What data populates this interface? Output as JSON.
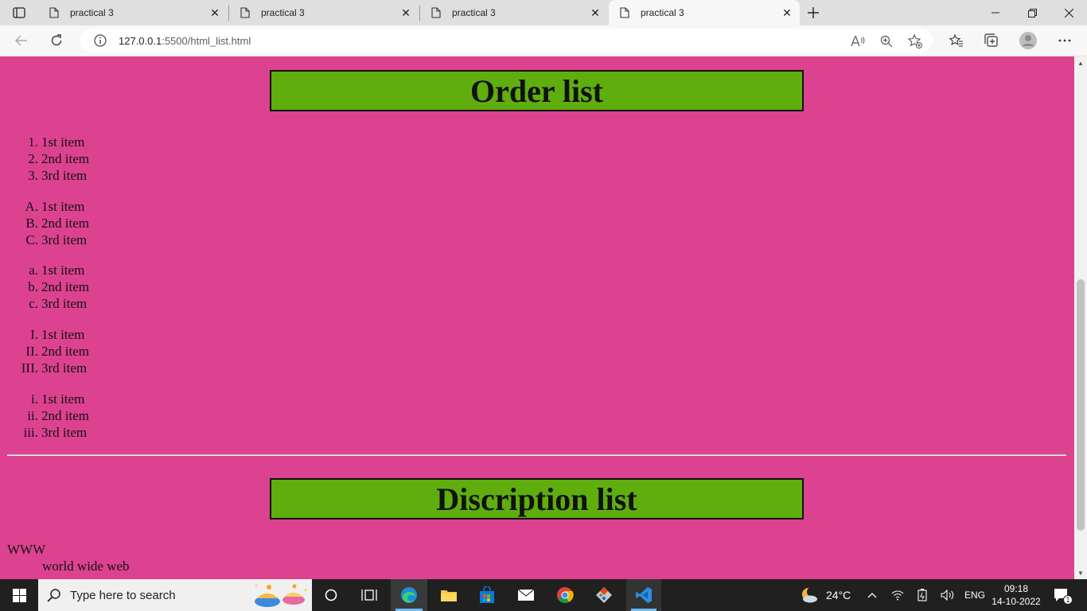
{
  "tabs": [
    {
      "title": "practical 3",
      "active": false
    },
    {
      "title": "practical 3",
      "active": false
    },
    {
      "title": "practical 3",
      "active": false
    },
    {
      "title": "practical 3",
      "active": true
    }
  ],
  "address": {
    "host": "127.0.0.1",
    "path": ":5500/html_list.html"
  },
  "page": {
    "order_heading": "Order list",
    "lists": [
      {
        "markers": [
          "1.",
          "2.",
          "3."
        ],
        "items": [
          "1st item",
          "2nd item",
          "3rd item"
        ]
      },
      {
        "markers": [
          "A.",
          "B.",
          "C."
        ],
        "items": [
          "1st item",
          "2nd item",
          "3rd item"
        ]
      },
      {
        "markers": [
          "a.",
          "b.",
          "c."
        ],
        "items": [
          "1st item",
          "2nd item",
          "3rd item"
        ]
      },
      {
        "markers": [
          "I.",
          "II.",
          "III."
        ],
        "items": [
          "1st item",
          "2nd item",
          "3rd item"
        ]
      },
      {
        "markers": [
          "i.",
          "ii.",
          "iii."
        ],
        "items": [
          "1st item",
          "2nd item",
          "3rd item"
        ]
      }
    ],
    "description_heading": "Discription list",
    "dl": {
      "term": "WWW",
      "definition": "world wide web"
    }
  },
  "taskbar": {
    "search_placeholder": "Type here to search",
    "weather": "24°C",
    "lang": "ENG",
    "time": "09:18",
    "date": "14-10-2022",
    "notification_count": "1"
  },
  "colors": {
    "page_bg": "#dd4290",
    "heading_bg": "#5fae0e",
    "taskbar_bg": "#202020"
  }
}
